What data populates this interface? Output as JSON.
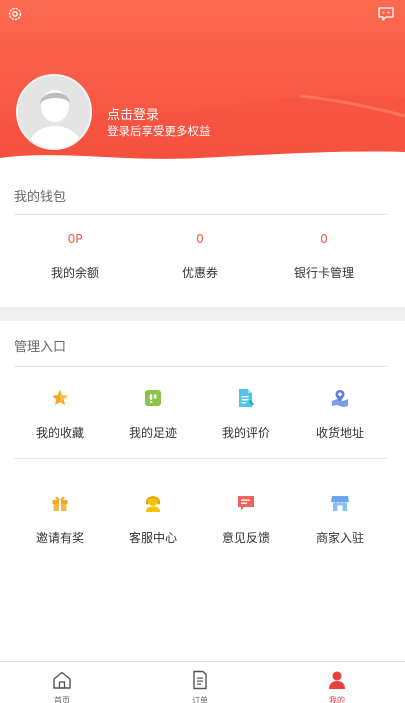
{
  "header": {
    "login_title": "点击登录",
    "login_subtitle": "登录后享受更多权益",
    "colors": {
      "gradient_top": "#fb6a4f",
      "gradient_bottom": "#f34b3c"
    }
  },
  "wallet": {
    "title": "我的钱包",
    "items": [
      {
        "value": "0P",
        "label": "我的余额"
      },
      {
        "value": "0",
        "label": "优惠券"
      },
      {
        "value": "0",
        "label": "银行卡管理"
      }
    ]
  },
  "management": {
    "title": "管理入口",
    "items": [
      {
        "label": "我的收藏",
        "icon": "star-icon",
        "color": "#f5a623"
      },
      {
        "label": "我的足迹",
        "icon": "footprint-icon",
        "color": "#8bc34a"
      },
      {
        "label": "我的评价",
        "icon": "review-doc-icon",
        "color": "#4fc3e8"
      },
      {
        "label": "收货地址",
        "icon": "location-map-icon",
        "color": "#7a9ee8"
      },
      {
        "label": "邀请有奖",
        "icon": "gift-icon",
        "color": "#f5a623"
      },
      {
        "label": "客服中心",
        "icon": "customer-service-icon",
        "color": "#f5c100"
      },
      {
        "label": "意见反馈",
        "icon": "feedback-icon",
        "color": "#f0625a"
      },
      {
        "label": "商家入驻",
        "icon": "store-icon",
        "color": "#6aa7e8"
      }
    ]
  },
  "tabbar": {
    "tabs": [
      {
        "label": "首页",
        "icon": "home-icon",
        "active": false
      },
      {
        "label": "订单",
        "icon": "order-doc-icon",
        "active": false
      },
      {
        "label": "我的",
        "icon": "profile-icon",
        "active": true
      }
    ],
    "active_color": "#e8413b"
  }
}
